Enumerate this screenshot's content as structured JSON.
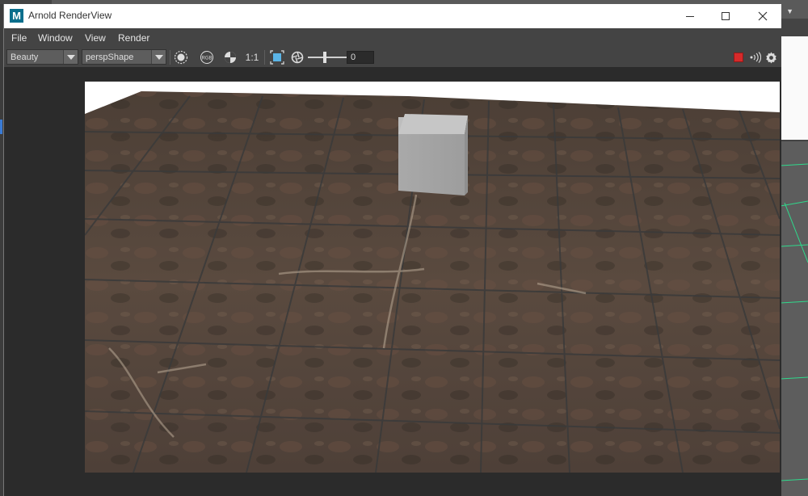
{
  "window": {
    "title": "Arnold RenderView",
    "logo_letter": "M"
  },
  "menu": {
    "items": [
      "File",
      "Window",
      "View",
      "Render"
    ]
  },
  "toolbar": {
    "aov_select": "Beauty",
    "camera_select": "perspShape",
    "ratio_label": "1:1",
    "exposure_value": "0",
    "rgb_label": "RGB"
  },
  "icons": {
    "window_controls": [
      "minimize-icon",
      "maximize-icon",
      "close-icon"
    ],
    "toolbar": [
      "display-circle-icon",
      "rgb-channel-icon",
      "contrast-icon",
      "crop-region-icon",
      "aperture-icon",
      "record-icon",
      "broadcast-icon",
      "gear-icon"
    ]
  },
  "colors": {
    "record": "#d62a2a",
    "logo": "#0a6e8c"
  }
}
